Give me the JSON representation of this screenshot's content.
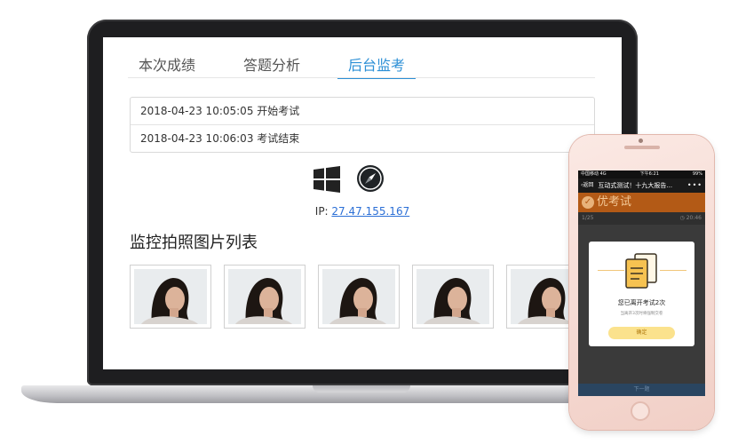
{
  "laptop": {
    "tabs": [
      {
        "label": "本次成绩",
        "active": false
      },
      {
        "label": "答题分析",
        "active": false
      },
      {
        "label": "后台监考",
        "active": true
      }
    ],
    "log": [
      "2018-04-23 10:05:05 开始考试",
      "2018-04-23 10:06:03 考试结束"
    ],
    "icons": {
      "os": "windows-icon",
      "browser": "safari-compass-icon"
    },
    "ip_label": "IP: ",
    "ip_value": "27.47.155.167",
    "section_title": "监控拍照图片列表",
    "photo_count": 5
  },
  "phone": {
    "status": {
      "carrier": "中国移动 4G",
      "time": "下午6:21",
      "battery": "99%"
    },
    "nav": {
      "back": "返回",
      "title": "互动式测试！十九大报告...",
      "more": "•••"
    },
    "app_title": "优考试",
    "progress": "1/25",
    "timer": "20:46",
    "dialog": {
      "title": "您已离开考试2次",
      "subtitle": "当离开3次时将强制交卷",
      "confirm": "确定"
    },
    "next_label": "下一题"
  },
  "colors": {
    "accent": "#2b8fd6",
    "link": "#2b6fd6",
    "brand": "#b35a16",
    "button": "#fbe28d"
  }
}
